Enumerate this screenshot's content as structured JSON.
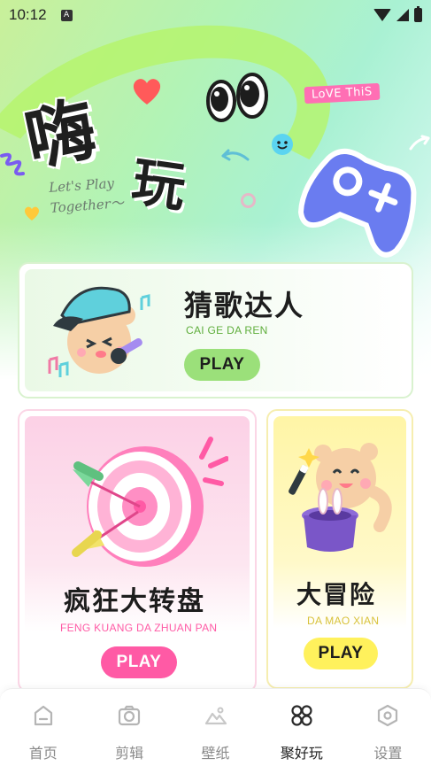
{
  "status_bar": {
    "time": "10:12",
    "notification_badge": "A",
    "icons": [
      "wifi-icon",
      "cellular-icon",
      "battery-icon"
    ]
  },
  "hero": {
    "title_char_1": "嗨",
    "title_char_2": "玩",
    "tagline_line1": "Let's Play",
    "tagline_line2": "Together～",
    "badge": "LoVE ThiS",
    "colors": {
      "title": "#1f1f1f",
      "badge": "#ff6fb4",
      "gamepad": "#6a7cf0"
    }
  },
  "games": [
    {
      "title": "猜歌达人",
      "subtitle": "CAI GE DA REN",
      "button": "PLAY",
      "accent": "#9be07a",
      "subtitle_color": "#5fae3c"
    },
    {
      "title": "疯狂大转盘",
      "subtitle": "FENG KUANG DA ZHUAN PAN",
      "button": "PLAY",
      "accent": "#ff5aa5",
      "subtitle_color": "#ff5aa5"
    },
    {
      "title": "大冒险",
      "subtitle": "DA MAO XIAN",
      "button": "PLAY",
      "accent": "#fff15c",
      "subtitle_color": "#d8c23a"
    }
  ],
  "nav": {
    "items": [
      {
        "label": "首页",
        "icon": "home-icon",
        "active": false
      },
      {
        "label": "剪辑",
        "icon": "camera-icon",
        "active": false
      },
      {
        "label": "壁纸",
        "icon": "mountain-icon",
        "active": false
      },
      {
        "label": "聚好玩",
        "icon": "grid-clover-icon",
        "active": true
      },
      {
        "label": "设置",
        "icon": "settings-hexagon-icon",
        "active": false
      }
    ]
  }
}
